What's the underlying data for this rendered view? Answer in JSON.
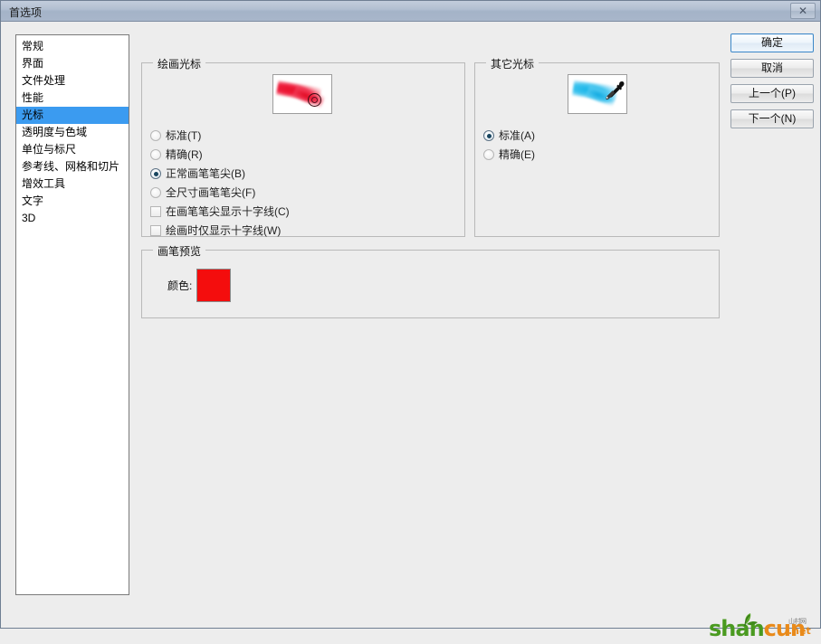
{
  "window": {
    "title": "首选项",
    "close_label": "✕",
    "bg_color": "#ededed",
    "titlebar_color": "#a8b6ca"
  },
  "sidebar": {
    "items": [
      {
        "label": "常规",
        "selected": false
      },
      {
        "label": "界面",
        "selected": false
      },
      {
        "label": "文件处理",
        "selected": false
      },
      {
        "label": "性能",
        "selected": false
      },
      {
        "label": "光标",
        "selected": true
      },
      {
        "label": "透明度与色域",
        "selected": false
      },
      {
        "label": "单位与标尺",
        "selected": false
      },
      {
        "label": "参考线、网格和切片",
        "selected": false
      },
      {
        "label": "增效工具",
        "selected": false
      },
      {
        "label": "文字",
        "selected": false
      },
      {
        "label": "3D",
        "selected": false
      }
    ],
    "selected_color": "#3b9bf0"
  },
  "painting_cursors": {
    "title": "绘画光标",
    "preview_icon": "red-brush-stroke-with-ring-cursor-preview",
    "options": [
      {
        "label": "标准(T)",
        "type": "radio",
        "checked": false
      },
      {
        "label": "精确(R)",
        "type": "radio",
        "checked": false
      },
      {
        "label": "正常画笔笔尖(B)",
        "type": "radio",
        "checked": true
      },
      {
        "label": "全尺寸画笔笔尖(F)",
        "type": "radio",
        "checked": false
      },
      {
        "label": "在画笔笔尖显示十字线(C)",
        "type": "checkbox",
        "checked": false
      },
      {
        "label": "绘画时仅显示十字线(W)",
        "type": "checkbox",
        "checked": false
      }
    ]
  },
  "other_cursors": {
    "title": "其它光标",
    "preview_icon": "cyan-stroke-with-eyedropper-preview",
    "options": [
      {
        "label": "标准(A)",
        "type": "radio",
        "checked": true
      },
      {
        "label": "精确(E)",
        "type": "radio",
        "checked": false
      }
    ]
  },
  "brush_preview": {
    "title": "画笔预览",
    "color_label": "颜色:",
    "color_value": "#f40d0d"
  },
  "buttons": {
    "ok": "确定",
    "cancel": "取消",
    "previous": "上一个(P)",
    "next": "下一个(N)"
  },
  "watermark": {
    "part1": "shan",
    "part2": "cun",
    "cn": "山村网",
    "tld": ".net",
    "color1": "#4a9a20",
    "color2": "#e98a1a"
  }
}
